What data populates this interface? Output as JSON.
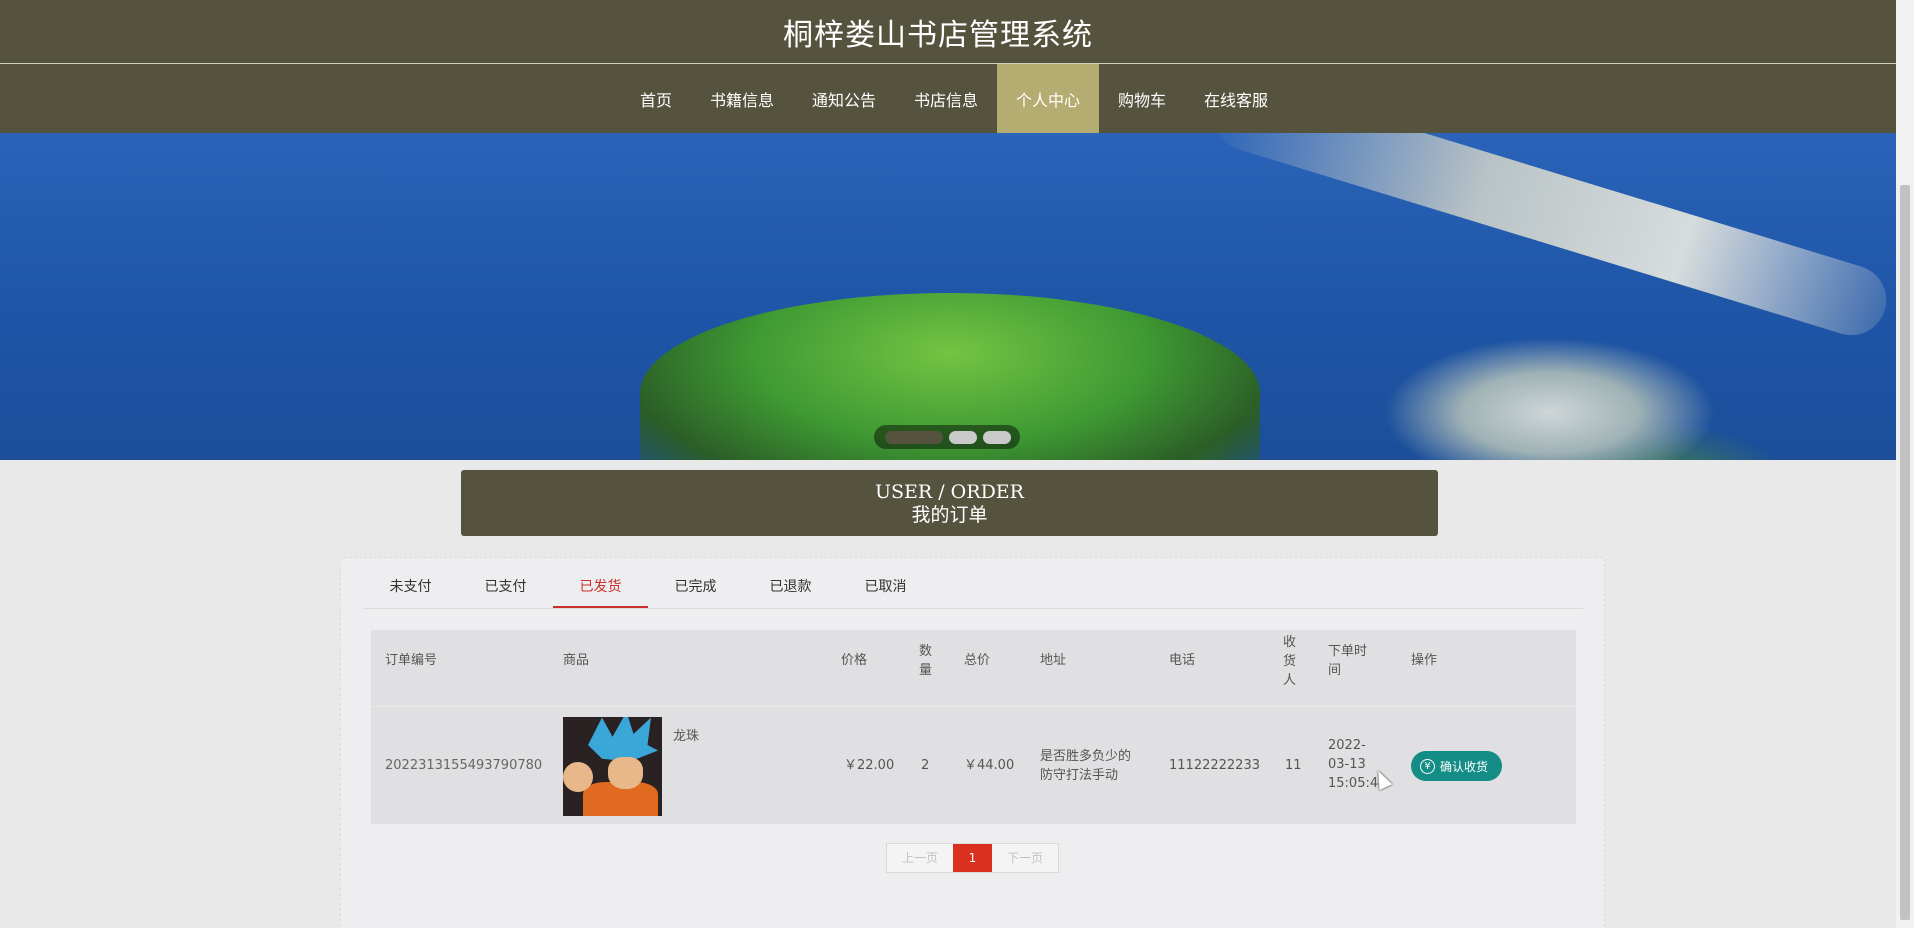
{
  "header": {
    "title": "桐梓娄山书店管理系统"
  },
  "nav": {
    "items": [
      "首页",
      "书籍信息",
      "通知公告",
      "书店信息",
      "个人中心",
      "购物车",
      "在线客服"
    ],
    "active_index": 4
  },
  "banner": {
    "slide_count": 3,
    "active_slide": 1
  },
  "section": {
    "title_en": "USER / ORDER",
    "title_cn": "我的订单"
  },
  "tabs": {
    "items": [
      "未支付",
      "已支付",
      "已发货",
      "已完成",
      "已退款",
      "已取消"
    ],
    "active_index": 2
  },
  "table": {
    "headers": {
      "order_no": "订单编号",
      "product": "商品",
      "price": "价格",
      "qty": "数量",
      "total": "总价",
      "address": "地址",
      "phone": "电话",
      "receiver": "收货人",
      "order_time": "下单时间",
      "action": "操作"
    },
    "rows": [
      {
        "order_no": "2022313155493790780",
        "product_name": "龙珠",
        "price": "￥22.00",
        "qty": "2",
        "total": "￥44.00",
        "address": "是否胜多负少的防守打法手动",
        "phone": "11122222233",
        "receiver": "11",
        "order_time": "2022-03-13 15:05:44",
        "action_label": "确认收货",
        "action_icon": "yen-icon"
      }
    ]
  },
  "pagination": {
    "prev": "上一页",
    "current": "1",
    "next": "下一页"
  },
  "colors": {
    "header_bg": "#55533e",
    "nav_active": "#b5ac72",
    "tab_active": "#c9302c",
    "confirm_button": "#138d86",
    "page_current": "#d9301f"
  }
}
